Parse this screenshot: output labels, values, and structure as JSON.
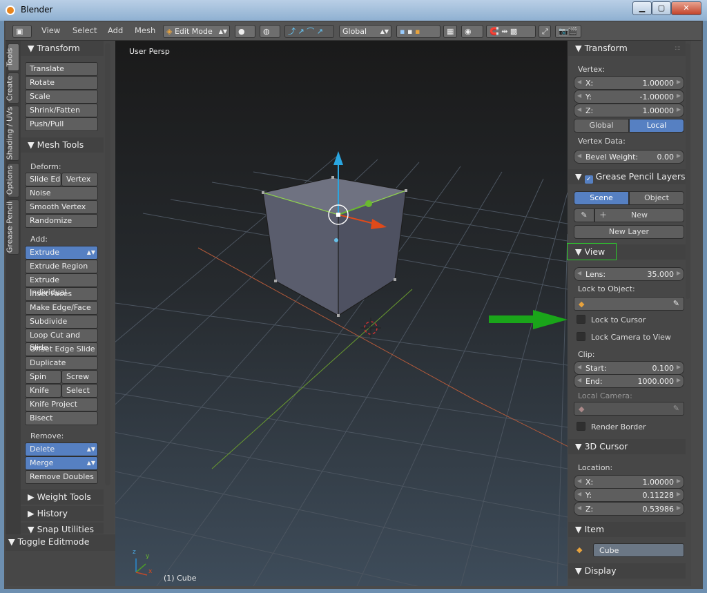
{
  "window": {
    "title": "Blender",
    "minimize": "▁",
    "maximize": "▢",
    "close": "✕"
  },
  "header": {
    "menus": [
      "View",
      "Select",
      "Add",
      "Mesh"
    ],
    "mode": "Edit Mode",
    "orientation": "Global"
  },
  "tabs": [
    "Tools",
    "Create",
    "Shading / UVs",
    "Options",
    "Grease Pencil"
  ],
  "toolshelf": {
    "transform_title": "Transform",
    "transform_buttons": [
      "Translate",
      "Rotate",
      "Scale",
      "Shrink/Fatten",
      "Push/Pull"
    ],
    "mesh_tools_title": "Mesh Tools",
    "deform_label": "Deform:",
    "slide_edge": "Slide Ed",
    "vertex": "Vertex",
    "noise": "Noise",
    "smooth_vertex": "Smooth Vertex",
    "randomize": "Randomize",
    "add_label": "Add:",
    "extrude": "Extrude",
    "add_buttons": [
      "Extrude Region",
      "Extrude Individual",
      "Inset Faces",
      "Make Edge/Face",
      "Subdivide",
      "Loop Cut and Slide",
      "Offset Edge Slide",
      "Duplicate"
    ],
    "spin": "Spin",
    "screw": "Screw",
    "knife": "Knife",
    "select": "Select",
    "knife_project": "Knife Project",
    "bisect": "Bisect",
    "remove_label": "Remove:",
    "delete": "Delete",
    "merge": "Merge",
    "remove_doubles": "Remove Doubles",
    "weight_tools": "Weight Tools",
    "history": "History",
    "snap_utilities": "Snap Utilities",
    "toggle_editmode": "Toggle Editmode"
  },
  "viewport": {
    "label": "User Persp",
    "object_label": "(1) Cube",
    "axis_x": "x",
    "axis_y": "y",
    "axis_z": "z"
  },
  "props": {
    "transform_title": "Transform",
    "vertex_label": "Vertex:",
    "vx": {
      "k": "X:",
      "v": "1.00000"
    },
    "vy": {
      "k": "Y:",
      "v": "-1.00000"
    },
    "vz": {
      "k": "Z:",
      "v": "1.00000"
    },
    "global": "Global",
    "local": "Local",
    "vertex_data_label": "Vertex Data:",
    "bevel": {
      "k": "Bevel Weight:",
      "v": "0.00"
    },
    "grease_title": "Grease Pencil Layers",
    "scene": "Scene",
    "object": "Object",
    "new": "New",
    "new_layer": "New Layer",
    "view_title": "View",
    "lens": {
      "k": "Lens:",
      "v": "35.000"
    },
    "lock_to_object": "Lock to Object:",
    "lock_to_cursor": "Lock to Cursor",
    "lock_camera": "Lock Camera to View",
    "clip_label": "Clip:",
    "clip_start": {
      "k": "Start:",
      "v": "0.100"
    },
    "clip_end": {
      "k": "End:",
      "v": "1000.000"
    },
    "local_camera": "Local Camera:",
    "render_border": "Render Border",
    "cursor_title": "3D Cursor",
    "location_label": "Location:",
    "cx": {
      "k": "X:",
      "v": "1.00000"
    },
    "cy": {
      "k": "Y:",
      "v": "0.11228"
    },
    "cz": {
      "k": "Z:",
      "v": "0.53986"
    },
    "item_title": "Item",
    "item_name": "Cube",
    "display_title": "Display"
  }
}
